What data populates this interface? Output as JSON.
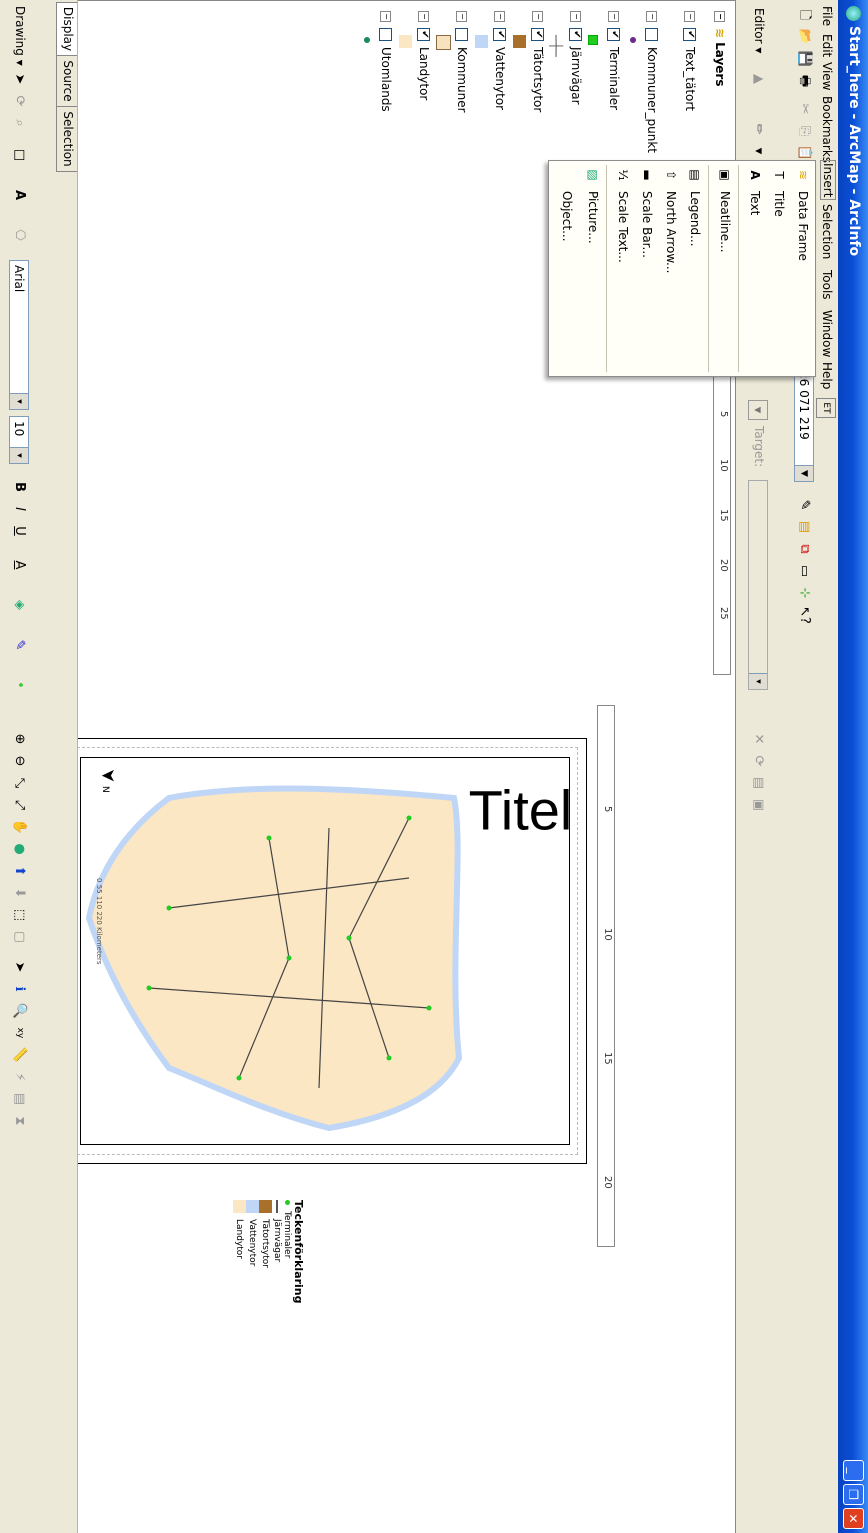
{
  "window": {
    "title": "Start_here - ArcMap - ArcInfo"
  },
  "menubar": {
    "items": [
      "File",
      "Edit",
      "View",
      "Bookmarks",
      "Insert",
      "Selection",
      "Tools",
      "Window",
      "Help"
    ]
  },
  "toolbar": {
    "scale_value": "1:6 071 219",
    "editor_label": "Editor",
    "target_label": "Target:",
    "task_label": "Ta"
  },
  "insert_menu": {
    "items": [
      "Data Frame",
      "Title",
      "Text",
      "Neatline...",
      "Legend...",
      "North Arrow...",
      "Scale Bar...",
      "Scale Text...",
      "Picture...",
      "Object..."
    ]
  },
  "toc": {
    "root": "Layers",
    "layers": [
      {
        "name": "Text_tätort",
        "checked": true,
        "sym": "none"
      },
      {
        "name": "Kommuner_punkt",
        "checked": false,
        "sym": "dot",
        "color": "#6b2a8a"
      },
      {
        "name": "Terminaler",
        "checked": true,
        "sym": "square",
        "color": "#22cc22"
      },
      {
        "name": "Järnvägar",
        "checked": true,
        "sym": "rail"
      },
      {
        "name": "Tätortsytor",
        "checked": true,
        "sym": "fill",
        "color": "#a8702a"
      },
      {
        "name": "Vattenytor",
        "checked": true,
        "sym": "fill",
        "color": "#bfd6f7"
      },
      {
        "name": "Kommuner",
        "checked": false,
        "sym": "fill",
        "color": "#f7e2c0"
      },
      {
        "name": "Landytor",
        "checked": true,
        "sym": "fill",
        "color": "#fbe7c4"
      },
      {
        "name": "Utomlands",
        "checked": false,
        "sym": "dot",
        "color": "#1b8a5a"
      }
    ],
    "tabs": [
      "Display",
      "Source",
      "Selection"
    ]
  },
  "ruler_h": {
    "labels": [
      "5",
      "10",
      "15",
      "20",
      "25"
    ]
  },
  "ruler_v": {
    "labels": [
      "5",
      "10",
      "15",
      "20"
    ]
  },
  "layout": {
    "title": "Titel",
    "legend_title": "Teckenförklaring",
    "legend_items": [
      {
        "label": "Terminaler",
        "color": "#22cc22",
        "sym": "dot"
      },
      {
        "label": "Järnvägar",
        "color": "#555555",
        "sym": "line"
      },
      {
        "label": "Tätortsytor",
        "color": "#a8702a",
        "sym": "fill"
      },
      {
        "label": "Vattenytor",
        "color": "#bfd6f7",
        "sym": "fill"
      },
      {
        "label": "Landytor",
        "color": "#fbe7c4",
        "sym": "fill"
      }
    ],
    "north_label": "N",
    "scalebar_label": "220 Kilometers",
    "scalebar_ticks": [
      "0",
      "55",
      "110"
    ]
  },
  "drawing": {
    "label": "Drawing",
    "font": "Arial",
    "font_size": "10"
  },
  "colors": {
    "titlebar": "#0a4fd6",
    "chrome": "#ece9d8",
    "land": "#fbe7c4",
    "water": "#bfd6f7"
  }
}
